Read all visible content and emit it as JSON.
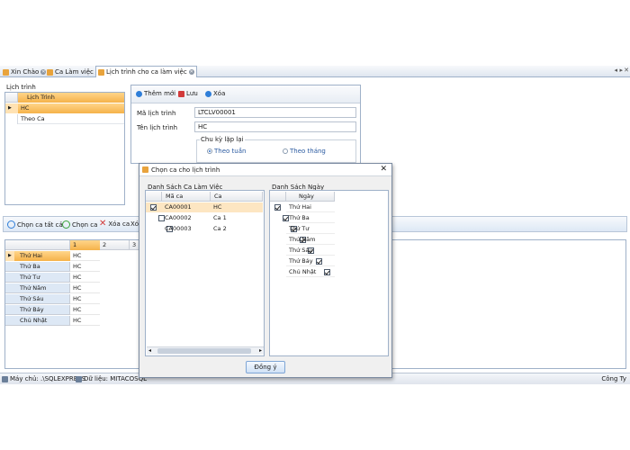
{
  "tabs": [
    {
      "label": "Xin Chào",
      "active": false
    },
    {
      "label": "Ca Làm việc",
      "active": false
    },
    {
      "label": "Lịch trình cho ca làm việc",
      "active": true
    }
  ],
  "tab_nav": {
    "prev": "◂",
    "next": "▸",
    "close": "✕"
  },
  "left_panel": {
    "title": "Lịch trình",
    "column_header": "Lịch Trình",
    "rows": [
      {
        "name": "HC",
        "selected": true
      },
      {
        "name": "Theo Ca",
        "selected": false
      }
    ]
  },
  "detail": {
    "toolbar": {
      "add": "Thêm mới",
      "save": "Lưu",
      "delete": "Xóa"
    },
    "code_label": "Mã lịch trình",
    "code_value": "LTCLV00001",
    "name_label": "Tên lịch trình",
    "name_value": "HC",
    "cycle_group": "Chu kỳ lặp lại",
    "weekly": "Theo tuần",
    "monthly": "Theo tháng"
  },
  "shift_toolbar": {
    "choose_all": "Chọn ca tất cả",
    "choose": "Chọn ca",
    "delete": "Xóa ca",
    "delete_all": "Xóa"
  },
  "schedule_grid": {
    "columns": [
      "1",
      "2",
      "3"
    ],
    "rows": [
      {
        "day": "Thứ Hai",
        "c1": "HC",
        "current": true
      },
      {
        "day": "Thứ Ba",
        "c1": "HC",
        "current": false
      },
      {
        "day": "Thứ Tư",
        "c1": "HC",
        "current": false
      },
      {
        "day": "Thứ Năm",
        "c1": "HC",
        "current": false
      },
      {
        "day": "Thứ Sáu",
        "c1": "HC",
        "current": false
      },
      {
        "day": "Thứ Bảy",
        "c1": "HC",
        "current": false
      },
      {
        "day": "Chủ Nhật",
        "c1": "HC",
        "current": false
      }
    ]
  },
  "dialog": {
    "title": "Chọn ca cho lịch trình",
    "close": "✕",
    "shifts_group": "Danh Sách Ca Làm Việc",
    "shifts_header": {
      "code": "Mã ca",
      "name": "Ca"
    },
    "shifts": [
      {
        "code": "CA00001",
        "name": "HC",
        "checked": true
      },
      {
        "code": "CA00002",
        "name": "Ca 1",
        "checked": false
      },
      {
        "code": "CA00003",
        "name": "Ca 2",
        "checked": false
      }
    ],
    "days_group": "Danh Sách Ngày",
    "days_header": "Ngày",
    "days": [
      {
        "name": "Thứ Hai",
        "checked": true
      },
      {
        "name": "Thứ Ba",
        "checked": true
      },
      {
        "name": "Thứ Tư",
        "checked": true
      },
      {
        "name": "Thứ Năm",
        "checked": true
      },
      {
        "name": "Thứ Sáu",
        "checked": true
      },
      {
        "name": "Thứ Bảy",
        "checked": true
      },
      {
        "name": "Chủ Nhật",
        "checked": true
      }
    ],
    "ok": "Đồng ý"
  },
  "status": {
    "server": "Máy chủ: .\\SQLEXPRESS",
    "database": "Dữ liệu: MITACOSQL",
    "company": "Công Ty"
  },
  "colors": {
    "accent_orange": "#f5b24a",
    "header_blue": "#dde8f5",
    "border": "#9fb1c9"
  }
}
